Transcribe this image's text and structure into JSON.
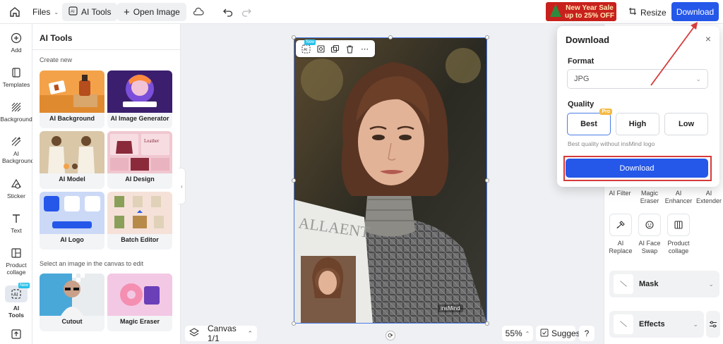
{
  "topbar": {
    "files_label": "Files",
    "ai_tools_label": "AI Tools",
    "open_image_label": "Open Image",
    "promo_line1": "New Year Sale",
    "promo_line2": "up to 25% OFF",
    "resize_label": "Resize",
    "download_label": "Download"
  },
  "rail": {
    "items": [
      {
        "label": "Add",
        "icon": "plus-circle-icon"
      },
      {
        "label": "Templates",
        "icon": "templates-icon"
      },
      {
        "label": "Background",
        "icon": "background-icon"
      },
      {
        "label": "AI Background",
        "icon": "ai-background-icon"
      },
      {
        "label": "Sticker",
        "icon": "sticker-icon"
      },
      {
        "label": "Text",
        "icon": "text-icon"
      },
      {
        "label": "Product collage",
        "icon": "collage-icon"
      },
      {
        "label": "AI Tools",
        "icon": "ai-tools-icon",
        "badge": "New"
      }
    ]
  },
  "panel": {
    "title": "AI Tools",
    "create_new": "Create new",
    "cards": [
      {
        "label": "AI Background"
      },
      {
        "label": "AI Image Generator"
      },
      {
        "label": "AI Model"
      },
      {
        "label": "AI Design"
      },
      {
        "label": "AI Logo"
      },
      {
        "label": "Batch Editor"
      }
    ],
    "select_hint": "Select an image in the canvas to edit",
    "edit_cards": [
      {
        "label": "Cutout"
      },
      {
        "label": "Magic Eraser"
      }
    ]
  },
  "canvas": {
    "watermark": "insMind",
    "magazine_text": "ALLAENT",
    "floating_badge": "New",
    "canvas_label": "Canvas 1/1",
    "zoom": "55%",
    "suggest_label": "Suggest",
    "help_label": "?"
  },
  "right_panel": {
    "tools_row1": [
      "AI Filter",
      "Magic Eraser",
      "AI Enhancer",
      "AI Extender"
    ],
    "tools_row2": [
      "AI Replace",
      "AI Face Swap",
      "Product collage"
    ],
    "mask_label": "Mask",
    "effects_label": "Effects"
  },
  "download_popup": {
    "title": "Download",
    "format_label": "Format",
    "format_value": "JPG",
    "quality_label": "Quality",
    "quality_options": [
      "Best",
      "High",
      "Low"
    ],
    "selected_quality": "Best",
    "pro_badge": "Pro",
    "hint": "Best quality without insMind logo",
    "download_button": "Download"
  },
  "colors": {
    "accent": "#2557e9",
    "highlight": "#d63a3a"
  }
}
